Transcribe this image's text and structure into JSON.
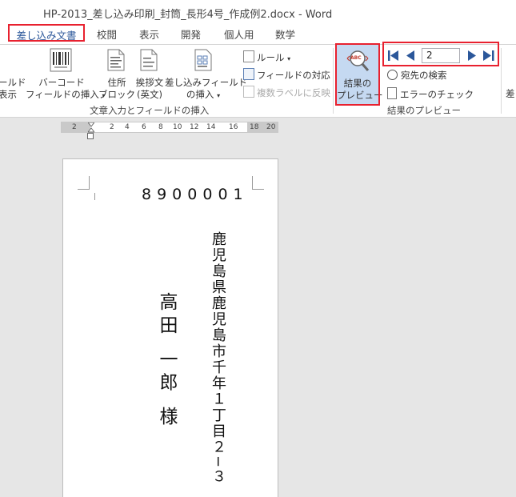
{
  "window": {
    "title": "HP-2013_差し込み印刷_封筒_長形4号_作成例2.docx - Word"
  },
  "tabs": [
    {
      "label": "差し込み文書",
      "active": true
    },
    {
      "label": "校閲"
    },
    {
      "label": "表示"
    },
    {
      "label": "開発"
    },
    {
      "label": "個人用"
    },
    {
      "label": "数学"
    }
  ],
  "ribbon": {
    "field_display_line1": "ールド",
    "field_display_line2": "表示",
    "barcode_line1": "バーコード",
    "barcode_line2": "フィールドの挿入",
    "address_line1": "住所",
    "address_line2": "ブロック",
    "greeting_line1": "挨拶文",
    "greeting_line2": "(英文)",
    "merge_field_line1": "差し込みフィールド",
    "merge_field_line2": "の挿入",
    "rules_label": "ルール",
    "match_fields_label": "フィールドの対応",
    "update_labels_label": "複数ラベルに反映",
    "group_write_insert": "文章入力とフィールドの挿入",
    "preview_line1": "結果の",
    "preview_line2": "プレビュー",
    "preview_icon_text": "ABC",
    "record_number": "2",
    "find_recipient_label": "宛先の検索",
    "check_errors_label": "エラーのチェック",
    "group_preview": "結果のプレビュー",
    "cutoff_label": "差"
  },
  "ruler": {
    "numbers": [
      "2",
      "2",
      "4",
      "6",
      "8",
      "10",
      "12",
      "14",
      "16",
      "18",
      "20"
    ]
  },
  "envelope": {
    "postal_code": "8900001",
    "address": "鹿児島県鹿児島市千年１丁目２−３",
    "recipient": "高田 一郎 様"
  },
  "colors": {
    "accent": "#2b579a",
    "highlight_box": "#e8212f",
    "preview_active": "#c5d9f1"
  }
}
